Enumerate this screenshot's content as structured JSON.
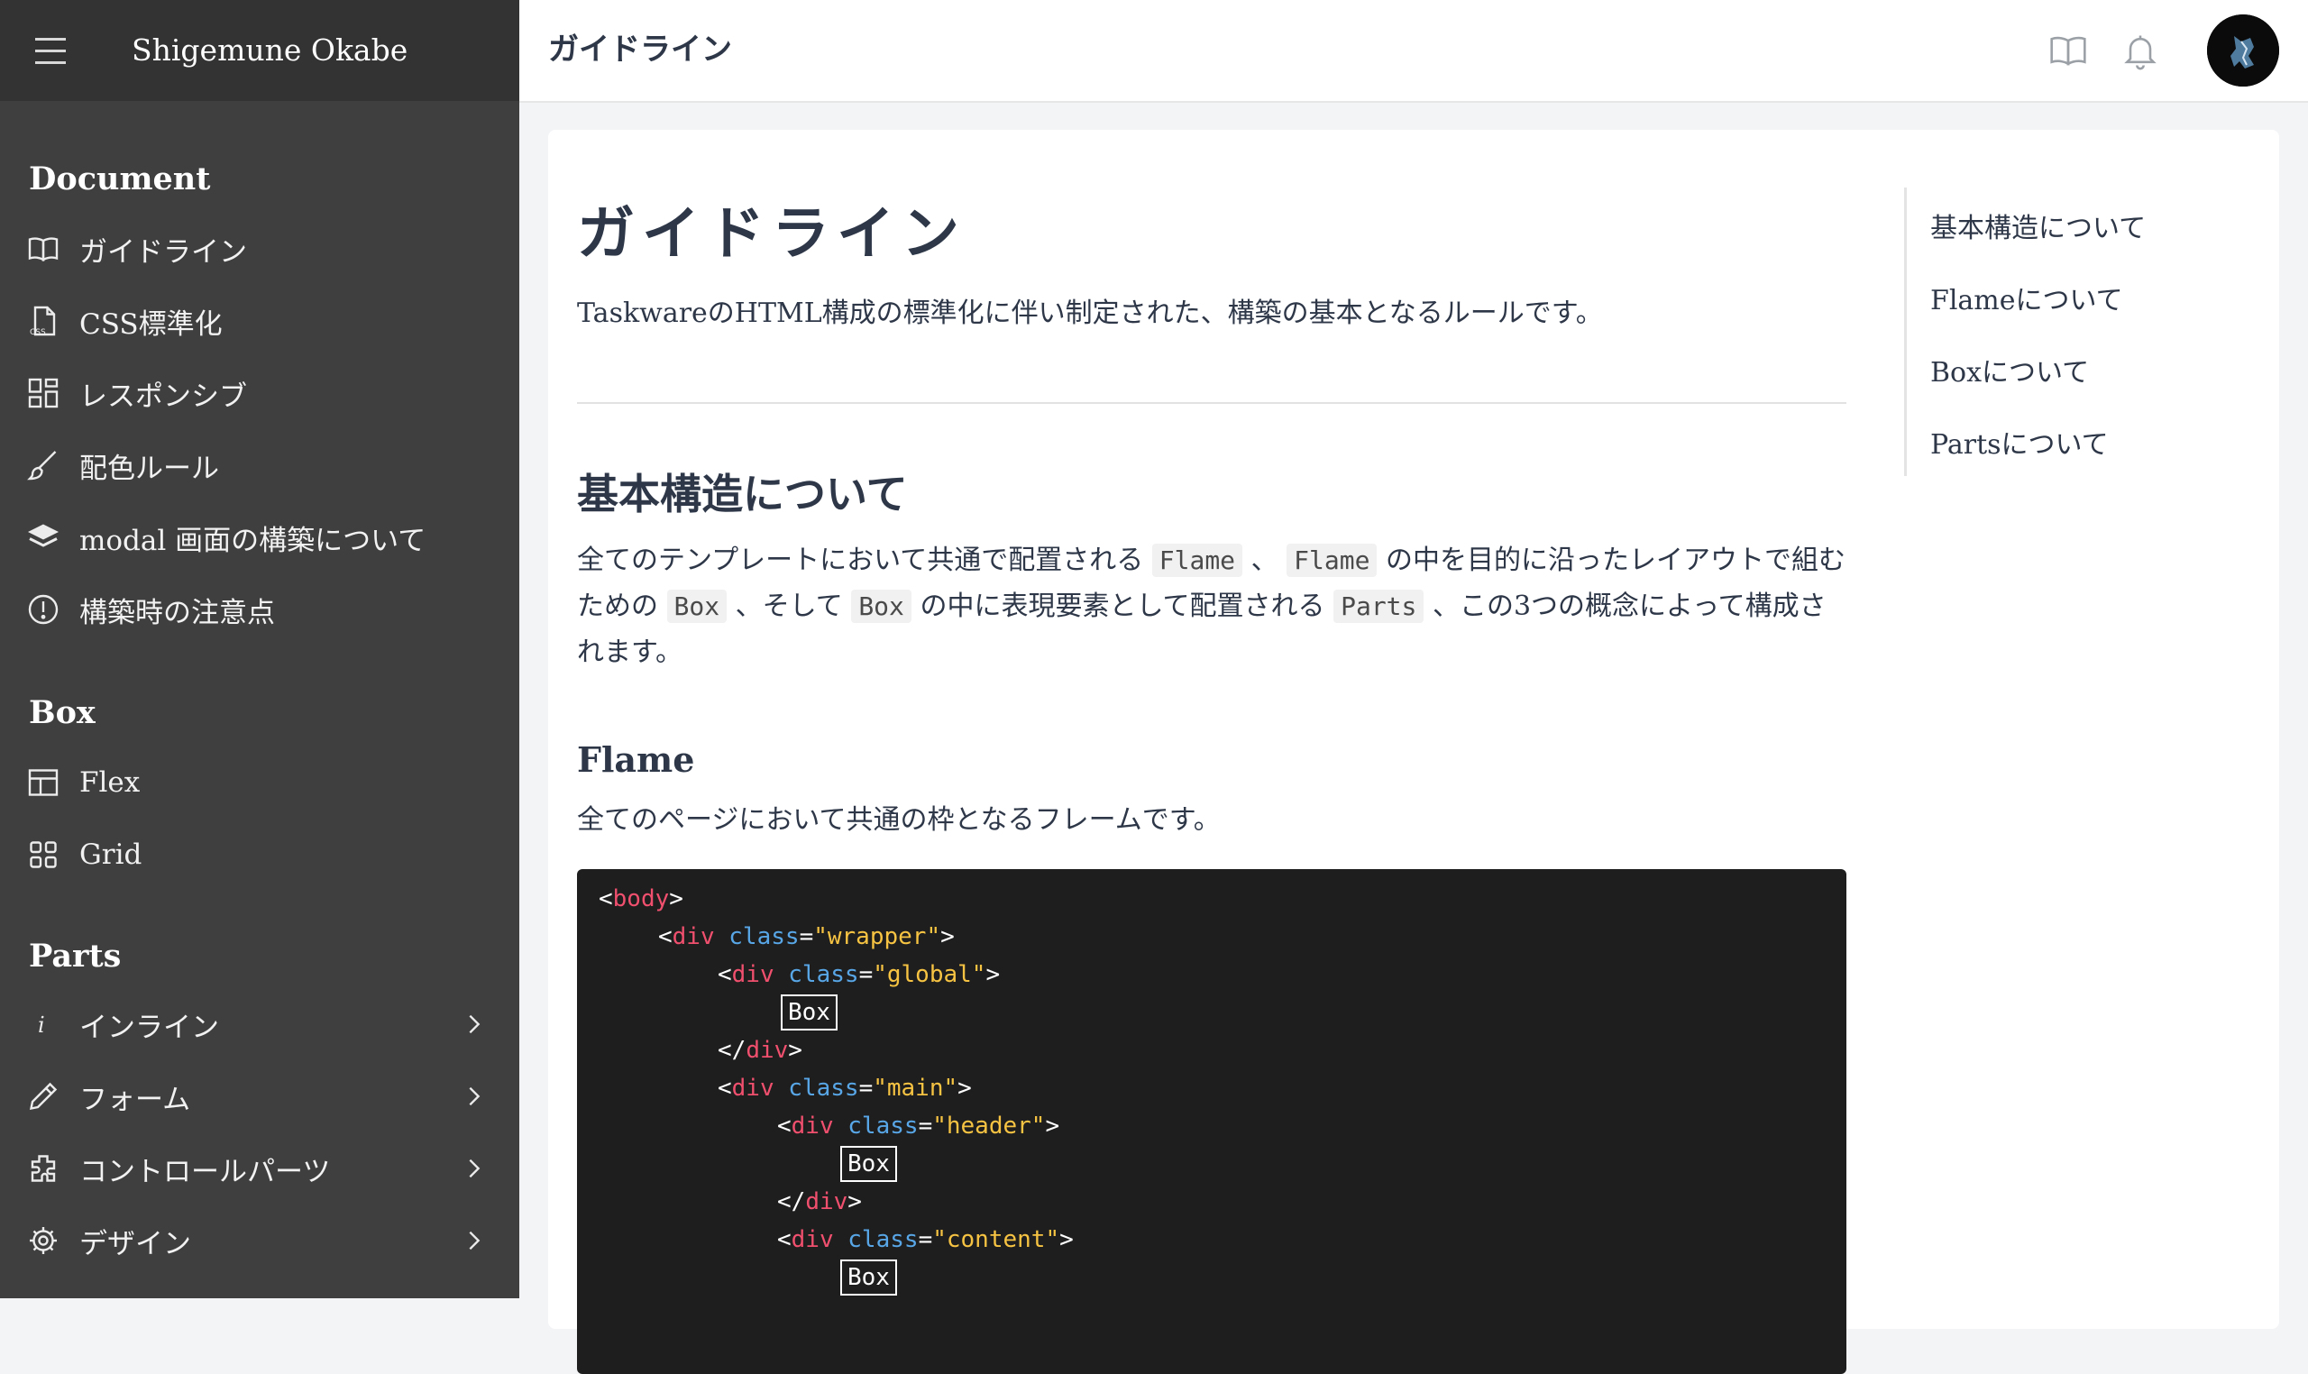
{
  "sidebar": {
    "user_name": "Shigemune Okabe",
    "sections": [
      {
        "title": "Document",
        "items": [
          {
            "label": "ガイドライン",
            "icon": "book-icon"
          },
          {
            "label": "CSS標準化",
            "icon": "css-file-icon"
          },
          {
            "label": "レスポンシブ",
            "icon": "responsive-grid-icon"
          },
          {
            "label": "配色ルール",
            "icon": "brush-icon"
          },
          {
            "label": "modal 画面の構築について",
            "icon": "layers-icon"
          },
          {
            "label": "構築時の注意点",
            "icon": "alert-circle-icon"
          }
        ]
      },
      {
        "title": "Box",
        "items": [
          {
            "label": "Flex",
            "icon": "flex-layout-icon"
          },
          {
            "label": "Grid",
            "icon": "grid-icon"
          }
        ]
      },
      {
        "title": "Parts",
        "items": [
          {
            "label": "インライン",
            "icon": "info-i-icon"
          },
          {
            "label": "フォーム",
            "icon": "pencil-icon"
          },
          {
            "label": "コントロールパーツ",
            "icon": "puzzle-icon"
          },
          {
            "label": "デザイン",
            "icon": "settings-icon"
          }
        ]
      }
    ]
  },
  "header": {
    "title": "ガイドライン"
  },
  "article": {
    "title": "ガイドライン",
    "lead": "TaskwareのHTML構成の標準化に伴い制定された、構築の基本となるルールです。",
    "basic": {
      "heading": "基本構造について",
      "p1": "全てのテンプレートにおいて共通で配置される",
      "code1": "Flame",
      "p2": "、",
      "code2": "Flame",
      "p3": "の中を目的に沿ったレイアウトで組むための",
      "code3": "Box",
      "p4": "、そして",
      "code4": "Box",
      "p5": "の中に表現要素として配置される",
      "code5": "Parts",
      "p6": "、この3つの概念によって構成されます。"
    },
    "flame": {
      "heading": "Flame",
      "desc": "全てのページにおいて共通の枠となるフレームです。"
    },
    "code": {
      "body_tag": "body",
      "div_tag": "div",
      "close_div": "</div>",
      "class_attr": "class",
      "wrapper": "\"wrapper\"",
      "global": "\"global\"",
      "main": "\"main\"",
      "header": "\"header\"",
      "content": "\"content\"",
      "box_label": "Box"
    }
  },
  "toc": {
    "items": [
      "基本構造について",
      "Flameについて",
      "Boxについて",
      "Partsについて"
    ]
  }
}
